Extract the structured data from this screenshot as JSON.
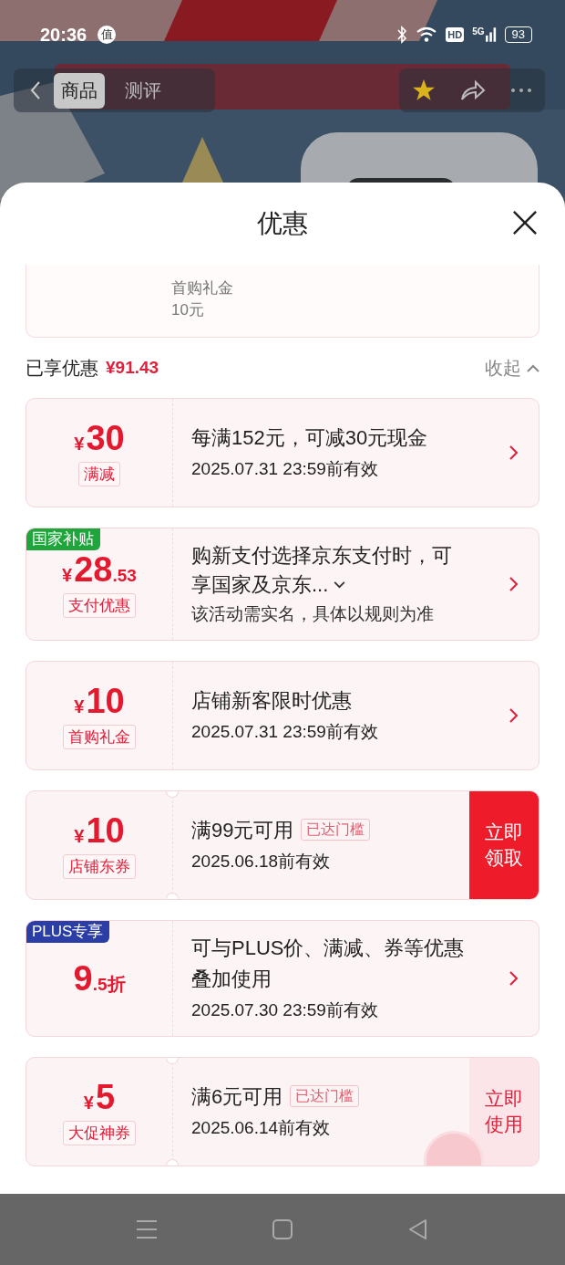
{
  "status_bar": {
    "time": "20:36",
    "badge": "值",
    "hd": "HD",
    "network": "5G",
    "battery": "93"
  },
  "product_nav": {
    "tabs": [
      {
        "label": "商品",
        "selected": true
      },
      {
        "label": "测评",
        "selected": false
      }
    ]
  },
  "sheet": {
    "title": "优惠"
  },
  "summary_card": {
    "gift_name": "首购礼金",
    "gift_value": "10元"
  },
  "savings": {
    "label": "已享优惠",
    "amount": "¥91.43",
    "toggle": "收起",
    "expanded": true
  },
  "coupons": [
    {
      "kind": "arrow",
      "notched": false,
      "currency": "¥",
      "amount": "30",
      "tag": "满减",
      "title": "每满152元，可减30元现金",
      "expiry": "2025.07.31 23:59前有效"
    },
    {
      "kind": "arrow",
      "notched": false,
      "badge": {
        "text": "国家补贴",
        "color": "#1ea53b"
      },
      "currency": "¥",
      "amount": "28",
      "decimal": ".53",
      "tag": "支付优惠",
      "title_lines": [
        "购新支付选择京东支付时，可",
        "享国家及京东..."
      ],
      "expandable": true,
      "note": "该活动需实名，具体以规则为准"
    },
    {
      "kind": "arrow",
      "notched": false,
      "currency": "¥",
      "amount": "10",
      "tag": "首购礼金",
      "title": "店铺新客限时优惠",
      "expiry": "2025.07.31 23:59前有效"
    },
    {
      "kind": "button",
      "notched": true,
      "currency": "¥",
      "amount": "10",
      "tag": "店铺东券",
      "title": "满99元可用",
      "threshold": "已达门槛",
      "expiry": "2025.06.18前有效",
      "action": {
        "label": "立即领取",
        "filled": true
      }
    },
    {
      "kind": "arrow",
      "notched": false,
      "badge": {
        "text": "PLUS专享",
        "color": "#2a3ea6"
      },
      "amount": "9",
      "decimal": ".5",
      "unit": "折",
      "title": "可与PLUS价、满减、券等优惠叠加使用",
      "expiry": "2025.07.30 23:59前有效"
    },
    {
      "kind": "button",
      "notched": true,
      "currency": "¥",
      "amount": "5",
      "tag": "大促神券",
      "title": "满6元可用",
      "threshold": "已达门槛",
      "expiry": "2025.06.14前有效",
      "action": {
        "label": "立即使用",
        "filled": false
      },
      "stamped": true
    }
  ]
}
